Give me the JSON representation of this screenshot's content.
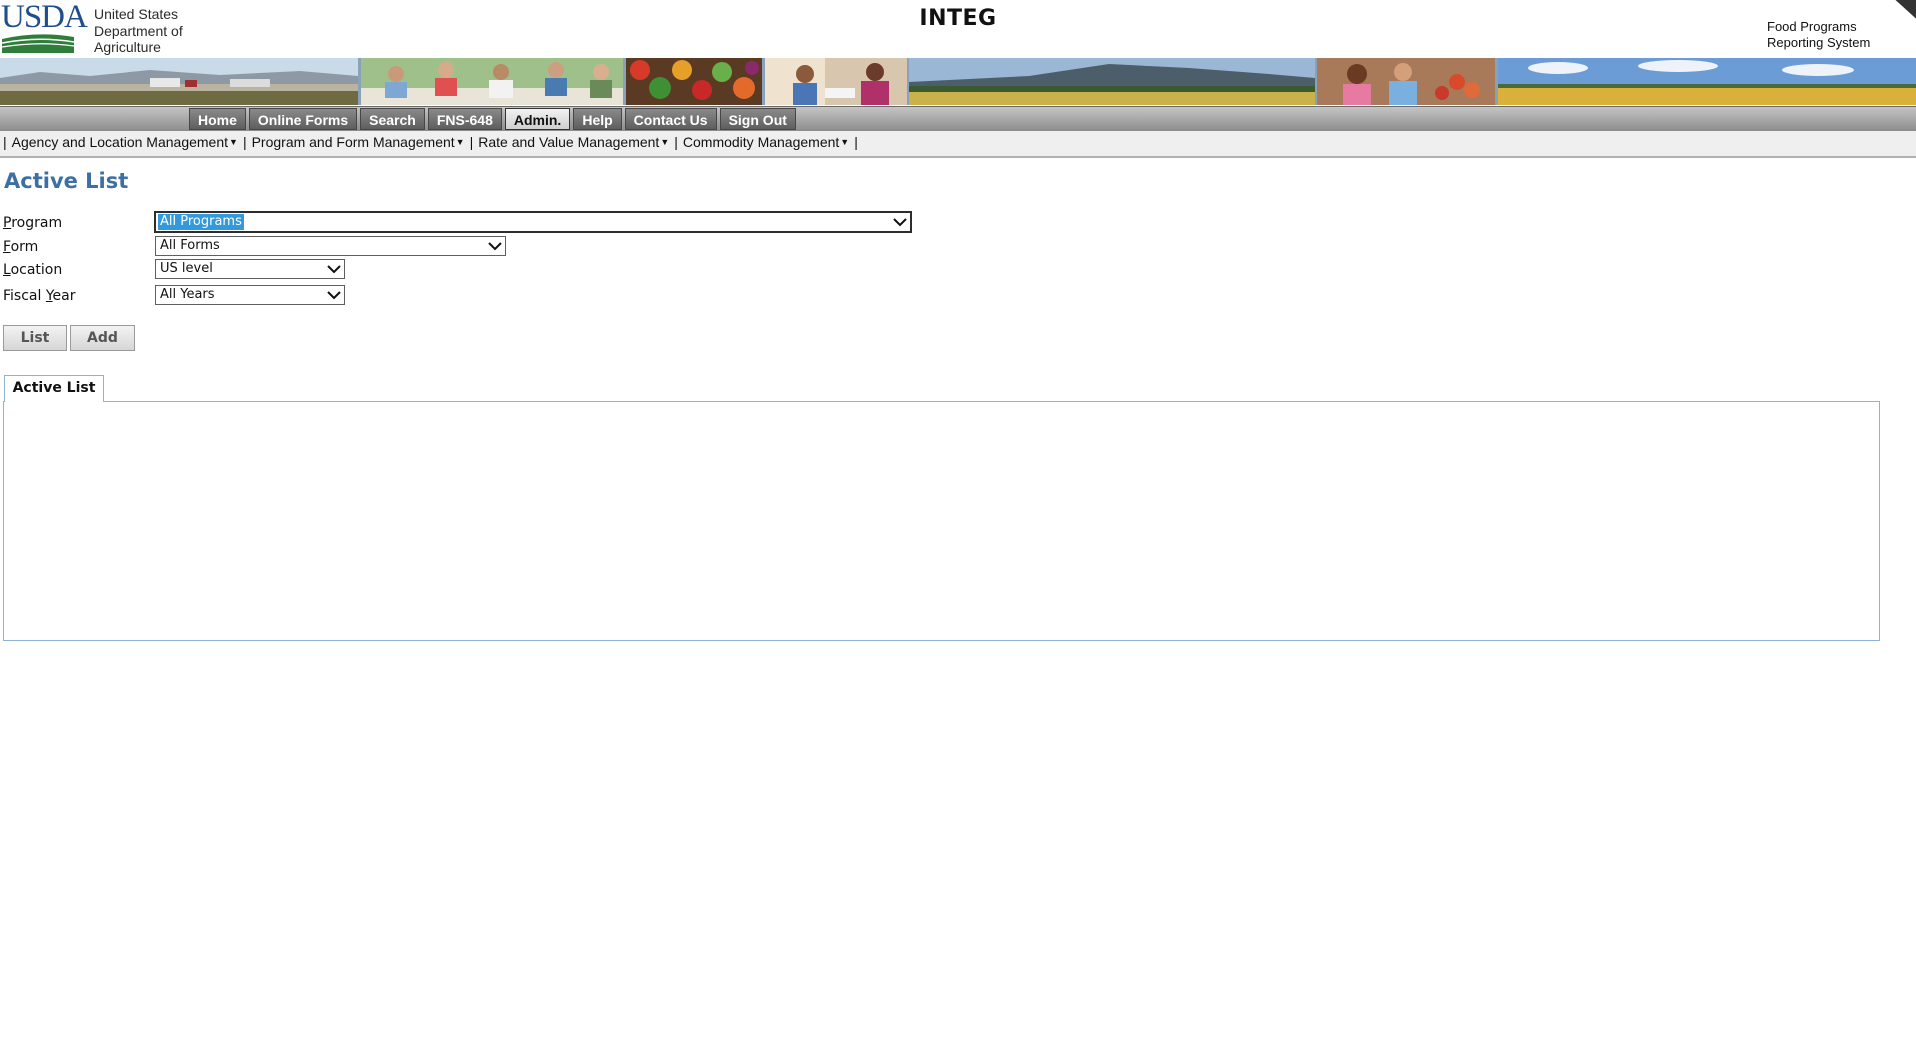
{
  "header": {
    "logo_text": "USDA",
    "department": "United States\nDepartment of\nAgriculture",
    "app_title": "INTEG",
    "system_name": "Food Programs\nReporting System"
  },
  "nav": {
    "tabs": [
      {
        "label": "Home",
        "active": false
      },
      {
        "label": "Online Forms",
        "active": false
      },
      {
        "label": "Search",
        "active": false
      },
      {
        "label": "FNS-648",
        "active": false
      },
      {
        "label": "Admin.",
        "active": true
      },
      {
        "label": "Help",
        "active": false
      },
      {
        "label": "Contact Us",
        "active": false
      },
      {
        "label": "Sign Out",
        "active": false
      }
    ]
  },
  "subnav": {
    "items": [
      "Agency and Location Management",
      "Program and Form Management",
      "Rate and Value Management",
      "Commodity Management"
    ]
  },
  "page": {
    "title": "Active List"
  },
  "filters": {
    "program": {
      "label_accesskey": "P",
      "label_rest": "rogram",
      "value": "All Programs"
    },
    "form": {
      "label_accesskey": "F",
      "label_rest": "orm",
      "value": "All Forms"
    },
    "location": {
      "label_accesskey": "L",
      "label_rest": "ocation",
      "value": "US level"
    },
    "fiscal_year": {
      "label_prefix": "Fiscal ",
      "label_accesskey": "Y",
      "label_rest": "ear",
      "value": "All Years"
    }
  },
  "buttons": {
    "list_label": "List",
    "add_label": "Add"
  },
  "results": {
    "tab_label": "Active List"
  },
  "colors": {
    "accent_title": "#3d6fa5",
    "selected_option": "#3399dd",
    "tab_border": "#8fb2d8",
    "usda_blue": "#1f4e8c",
    "usda_green": "#2e7d3a"
  }
}
